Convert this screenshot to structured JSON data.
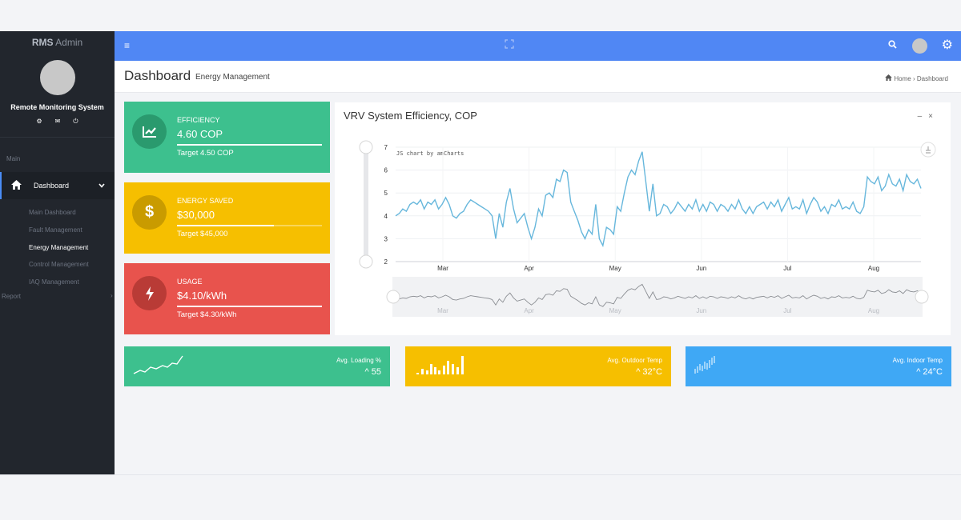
{
  "sidebar": {
    "brand_bold": "RMS",
    "brand_rest": "Admin",
    "system_name": "Remote Monitoring System",
    "section_main": "Main",
    "dashboard_label": "Dashboard",
    "items": [
      {
        "label": "Main Dashboard",
        "active": false
      },
      {
        "label": "Fault Management",
        "active": false
      },
      {
        "label": "Energy Management",
        "active": true
      },
      {
        "label": "Control Management",
        "active": false
      },
      {
        "label": "IAQ Management",
        "active": false
      }
    ],
    "report_label": "Report"
  },
  "header": {
    "title": "Dashboard",
    "subtitle": "Energy Management",
    "breadcrumb_home": "Home",
    "breadcrumb_current": "Dashboard"
  },
  "cards": [
    {
      "key": "efficiency",
      "title": "EFFICIENCY",
      "value": "4.60 COP",
      "target": "Target 4.50 COP",
      "progress": 1.0,
      "bg": "#3dc08e",
      "circle": "#2a9a6e",
      "icon": "chart-line-icon"
    },
    {
      "key": "energy_saved",
      "title": "ENERGY SAVED",
      "value": "$30,000",
      "target": "Target $45,000",
      "progress": 0.67,
      "bg": "#f6bf00",
      "circle": "#c99b00",
      "icon": "dollar-icon"
    },
    {
      "key": "usage",
      "title": "USAGE",
      "value": "$4.10/kWh",
      "target": "Target $4.30/kWh",
      "progress": 1.0,
      "bg": "#e8534d",
      "circle": "#b93b36",
      "icon": "bolt-icon"
    }
  ],
  "chart": {
    "title": "VRV System Efficiency, COP",
    "credit": "JS chart by amCharts",
    "chart_data": {
      "type": "line",
      "x_ticks": [
        "Mar",
        "Apr",
        "May",
        "Jun",
        "Jul",
        "Aug"
      ],
      "y_ticks": [
        "7",
        "6",
        "5",
        "4",
        "3",
        "2"
      ],
      "ylim": [
        2,
        7
      ],
      "series": [
        {
          "values": [
            4.0,
            4.1,
            4.3,
            4.2,
            4.5,
            4.6,
            4.5,
            4.7,
            4.3,
            4.6,
            4.5,
            4.7,
            4.3,
            4.5,
            4.8,
            4.5,
            4.0,
            3.9,
            4.1,
            4.2,
            4.5,
            4.7,
            4.6,
            4.5,
            4.4,
            4.3,
            4.2,
            4.0,
            3.0,
            4.1,
            3.5,
            4.6,
            5.2,
            4.3,
            3.7,
            3.9,
            4.1,
            3.5,
            3.0,
            3.5,
            4.3,
            4.0,
            4.9,
            5.0,
            4.8,
            5.6,
            5.5,
            6.0,
            5.9,
            4.6,
            4.2,
            3.8,
            3.3,
            3.0,
            3.4,
            3.2,
            4.5,
            3.0,
            2.7,
            3.5,
            3.4,
            3.2,
            4.4,
            4.2,
            5.0,
            5.7,
            6.0,
            5.8,
            6.4,
            6.8,
            5.5,
            4.2,
            5.4,
            4.0,
            4.1,
            4.5,
            4.4,
            4.1,
            4.3,
            4.6,
            4.4,
            4.2,
            4.5,
            4.3,
            4.7,
            4.2,
            4.5,
            4.2,
            4.6,
            4.5,
            4.2,
            4.5,
            4.4,
            4.2,
            4.5,
            4.3,
            4.7,
            4.3,
            4.1,
            4.4,
            4.1,
            4.4,
            4.5,
            4.6,
            4.3,
            4.6,
            4.4,
            4.7,
            4.2,
            4.5,
            4.8,
            4.3,
            4.4,
            4.3,
            4.7,
            4.1,
            4.5,
            4.8,
            4.6,
            4.2,
            4.4,
            4.1,
            4.5,
            4.4,
            4.7,
            4.3,
            4.4,
            4.3,
            4.6,
            4.2,
            4.1,
            4.4,
            5.7,
            5.5,
            5.4,
            5.7,
            5.1,
            5.3,
            5.8,
            5.4,
            5.3,
            5.6,
            5.1,
            5.8,
            5.5,
            5.4,
            5.6,
            5.2
          ]
        }
      ],
      "grid": true,
      "scrollbar": true
    }
  },
  "bottom_cards": [
    {
      "key": "loading",
      "label": "Avg. Loading %",
      "value": "^ 55",
      "bg": "#3dc08e",
      "spark": "line"
    },
    {
      "key": "outdoor",
      "label": "Avg. Outdoor Temp",
      "value": "^ 32°C",
      "bg": "#f6bf00",
      "spark": "bars"
    },
    {
      "key": "indoor",
      "label": "Avg. Indoor Temp",
      "value": "^ 24°C",
      "bg": "#3fa8f5",
      "spark": "ticks"
    }
  ]
}
